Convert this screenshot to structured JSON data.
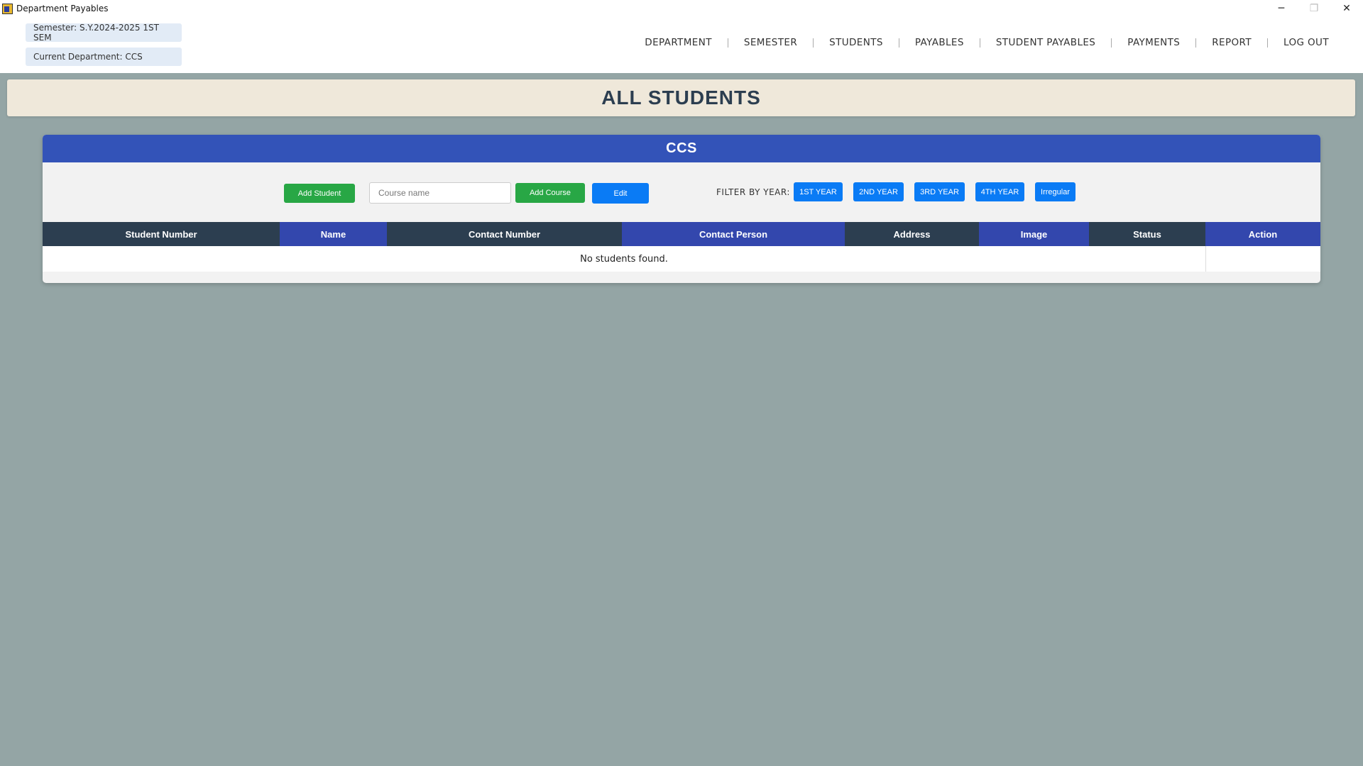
{
  "window": {
    "title": "Department Payables",
    "controls": {
      "minimize": "─",
      "maximize": "❐",
      "close": "✕"
    }
  },
  "header": {
    "semester": "Semester: S.Y.2024-2025 1ST SEM",
    "department": "Current Department: CCS",
    "nav": [
      "DEPARTMENT",
      "SEMESTER",
      "STUDENTS",
      "PAYABLES",
      "STUDENT PAYABLES",
      "PAYMENTS",
      "REPORT",
      "LOG OUT"
    ]
  },
  "banner": {
    "title": "ALL STUDENTS"
  },
  "card": {
    "title": "CCS",
    "toolbar": {
      "add_student": "Add Student",
      "course_placeholder": "Course name",
      "add_course": "Add Course",
      "edit": "Edit",
      "filter_label": "FILTER BY YEAR:",
      "filters": [
        "1ST YEAR",
        "2ND YEAR",
        "3RD YEAR",
        "4TH YEAR",
        "Irregular"
      ]
    },
    "table": {
      "columns": [
        "Student Number",
        "Name",
        "Contact Number",
        "Contact Person",
        "Address",
        "Image",
        "Status",
        "Action"
      ],
      "empty_message": "No students found."
    }
  },
  "colors": {
    "background": "#94a5a5",
    "banner": "#efe8da",
    "card_header": "#3353b8",
    "header_dark": "#2c3e50",
    "header_blue": "#3347ad",
    "green_button": "#28a745",
    "blue_button": "#0a7bf5"
  }
}
